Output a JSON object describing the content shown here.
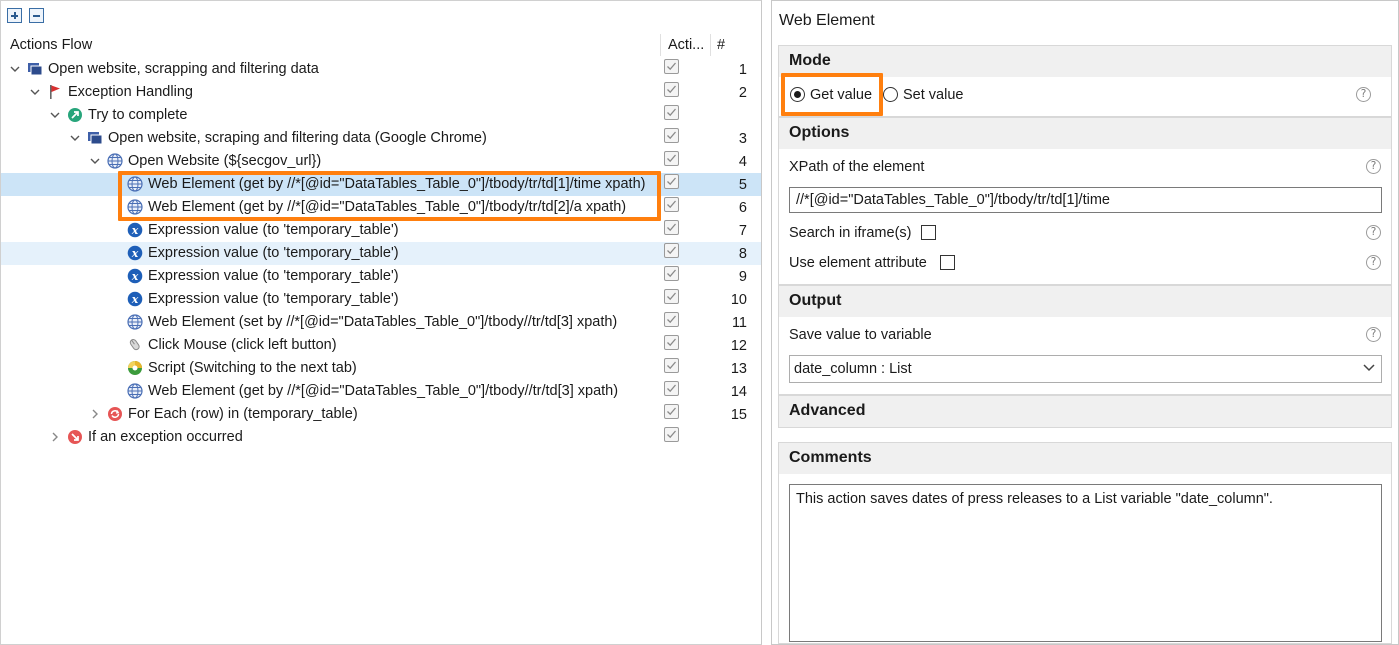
{
  "left_panel": {
    "columns": {
      "flow": "Actions Flow",
      "active": "Acti...",
      "number": "#"
    },
    "rows": [
      {
        "label": "Open website, scrapping and filtering data",
        "num": "1",
        "icon": "group-icon",
        "level": 0,
        "twisty": "expanded"
      },
      {
        "label": "Exception Handling",
        "num": "2",
        "icon": "flag-icon",
        "level": 1,
        "twisty": "expanded"
      },
      {
        "label": "Try to complete",
        "num": "",
        "icon": "try-icon",
        "level": 2,
        "twisty": "expanded"
      },
      {
        "label": "Open website, scraping and filtering data (Google Chrome)",
        "num": "3",
        "icon": "group-icon",
        "level": 3,
        "twisty": "expanded"
      },
      {
        "label": "Open Website (${secgov_url})",
        "num": "4",
        "icon": "globe-icon",
        "level": 4,
        "twisty": "expanded"
      },
      {
        "label": "Web Element (get by //*[@id=\"DataTables_Table_0\"]/tbody/tr/td[1]/time xpath)",
        "num": "5",
        "icon": "globe-icon",
        "level": 5,
        "twisty": "none"
      },
      {
        "label": "Web Element (get by //*[@id=\"DataTables_Table_0\"]/tbody/tr/td[2]/a xpath)",
        "num": "6",
        "icon": "globe-icon",
        "level": 5,
        "twisty": "none"
      },
      {
        "label": "Expression value (to 'temporary_table')",
        "num": "7",
        "icon": "expression-icon",
        "level": 5,
        "twisty": "none"
      },
      {
        "label": "Expression value (to 'temporary_table')",
        "num": "8",
        "icon": "expression-icon",
        "level": 5,
        "twisty": "none"
      },
      {
        "label": "Expression value (to 'temporary_table')",
        "num": "9",
        "icon": "expression-icon",
        "level": 5,
        "twisty": "none"
      },
      {
        "label": "Expression value (to 'temporary_table')",
        "num": "10",
        "icon": "expression-icon",
        "level": 5,
        "twisty": "none"
      },
      {
        "label": "Web Element (set by //*[@id=\"DataTables_Table_0\"]/tbody//tr/td[3] xpath)",
        "num": "11",
        "icon": "globe-icon",
        "level": 5,
        "twisty": "none"
      },
      {
        "label": "Click Mouse (click left button)",
        "num": "12",
        "icon": "mouse-icon",
        "level": 5,
        "twisty": "none"
      },
      {
        "label": "Script (Switching to the next tab)",
        "num": "13",
        "icon": "script-icon",
        "level": 5,
        "twisty": "none"
      },
      {
        "label": "Web Element (get by //*[@id=\"DataTables_Table_0\"]/tbody//tr/td[3] xpath)",
        "num": "14",
        "icon": "globe-icon",
        "level": 5,
        "twisty": "none"
      },
      {
        "label": "For Each (row) in (temporary_table)",
        "num": "15",
        "icon": "foreach-icon",
        "level": 4,
        "twisty": "collapsed"
      },
      {
        "label": "If an exception occurred",
        "num": "",
        "icon": "exception-icon",
        "level": 2,
        "twisty": "collapsed"
      }
    ]
  },
  "right_panel": {
    "title": "Web Element",
    "mode": {
      "header": "Mode",
      "get_label": "Get value",
      "set_label": "Set value",
      "selected": "get"
    },
    "options": {
      "header": "Options",
      "xpath_label": "XPath of the element",
      "xpath_value": "//*[@id=\"DataTables_Table_0\"]/tbody/tr/td[1]/time",
      "iframe_label": "Search in iframe(s)",
      "attribute_label": "Use element attribute"
    },
    "output": {
      "header": "Output",
      "save_label": "Save value to variable",
      "variable_value": "date_column : List"
    },
    "advanced": {
      "header": "Advanced"
    },
    "comments": {
      "header": "Comments",
      "text": "This action saves dates of press releases to a List variable \"date_column\"."
    },
    "help_glyph": "?"
  },
  "colors": {
    "highlight": "#ff7f0e",
    "selection": "#cce4f7",
    "hover": "#e5f1fb"
  }
}
